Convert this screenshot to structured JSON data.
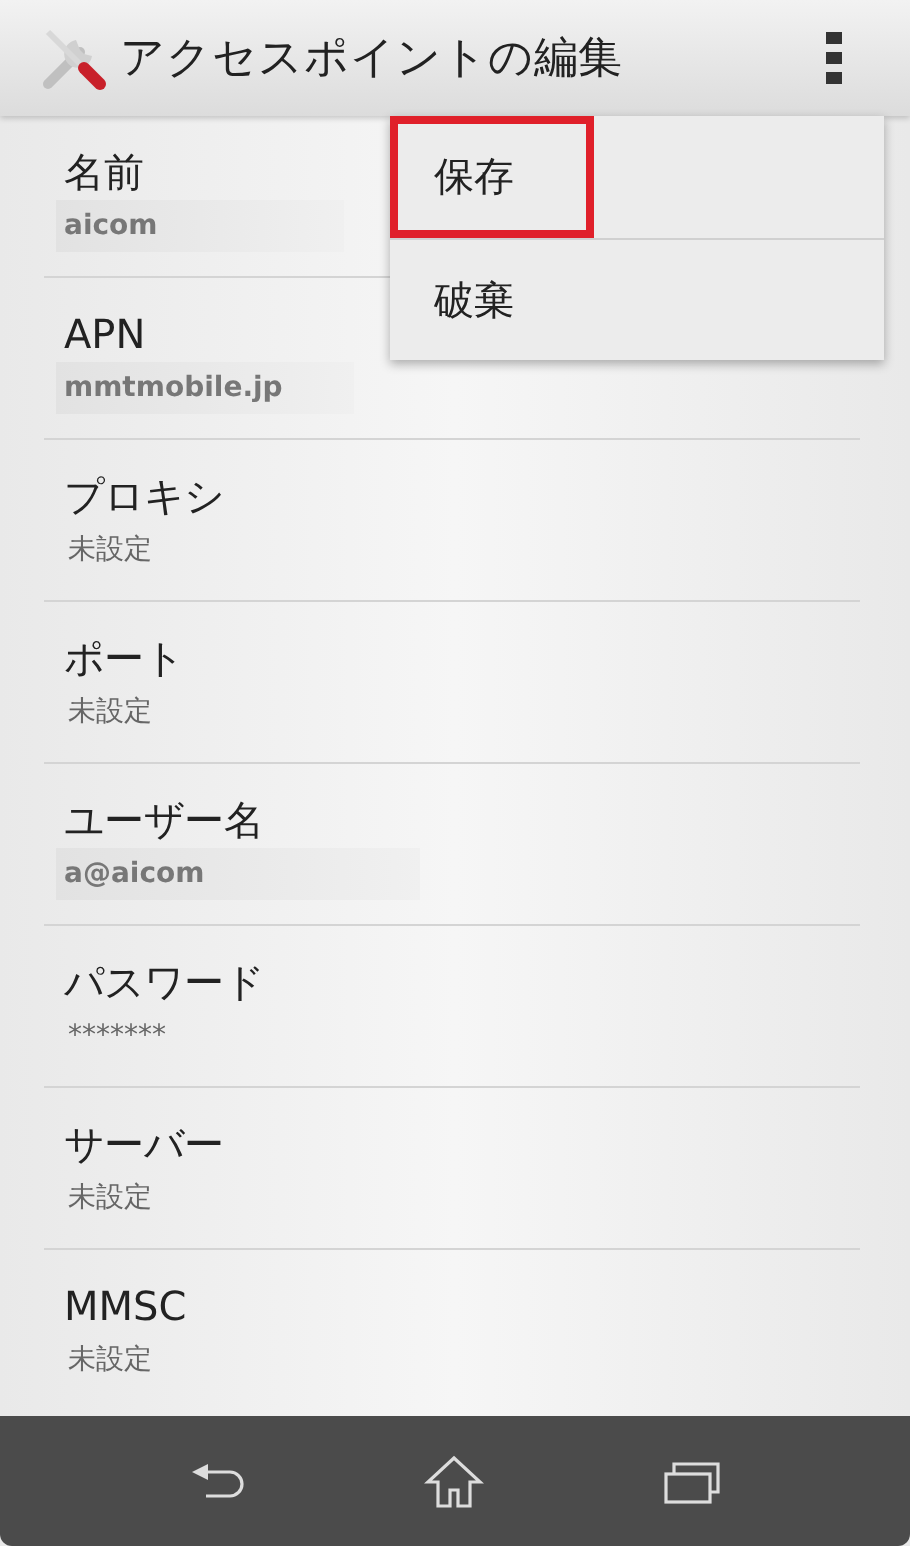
{
  "action_bar": {
    "title": "アクセスポイントの編集"
  },
  "settings": [
    {
      "label": "名前",
      "value": "aicom",
      "shaded": true
    },
    {
      "label": "APN",
      "value": "mmtmobile.jp",
      "shaded": true
    },
    {
      "label": "プロキシ",
      "value": "未設定",
      "shaded": false
    },
    {
      "label": "ポート",
      "value": "未設定",
      "shaded": false
    },
    {
      "label": "ユーザー名",
      "value": "a@aicom",
      "shaded": true
    },
    {
      "label": "パスワード",
      "value": "*******",
      "shaded": false
    },
    {
      "label": "サーバー",
      "value": "未設定",
      "shaded": false
    },
    {
      "label": "MMSC",
      "value": "未設定",
      "shaded": false
    }
  ],
  "overflow_menu": {
    "items": [
      {
        "label": "保存",
        "highlighted": true
      },
      {
        "label": "破棄",
        "highlighted": false
      }
    ]
  }
}
